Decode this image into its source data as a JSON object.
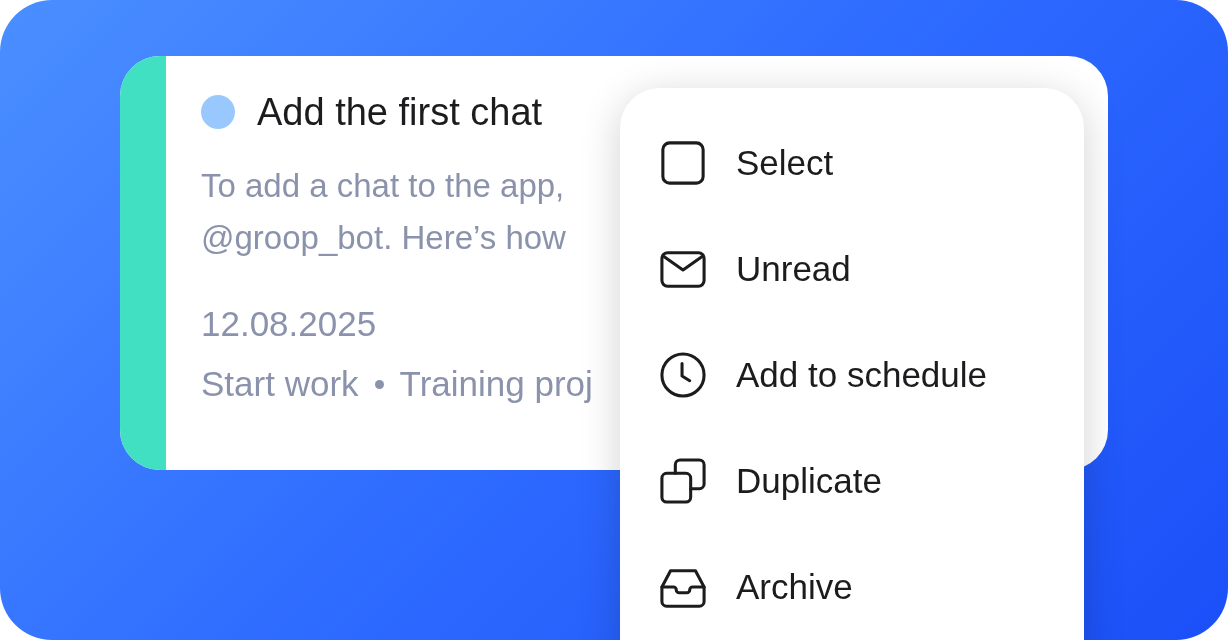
{
  "card": {
    "title": "Add the first chat",
    "description": [
      "To add a chat to the app,",
      "@groop_bot. Here’s how"
    ],
    "date": "12.08.2025",
    "tags": [
      "Start work",
      "Training proj"
    ]
  },
  "context_menu": {
    "items": [
      {
        "kind": "select",
        "label": "Select"
      },
      {
        "kind": "unread",
        "label": "Unread"
      },
      {
        "kind": "schedule",
        "label": "Add to schedule"
      },
      {
        "kind": "duplicate",
        "label": "Duplicate"
      },
      {
        "kind": "archive",
        "label": "Archive"
      }
    ]
  }
}
